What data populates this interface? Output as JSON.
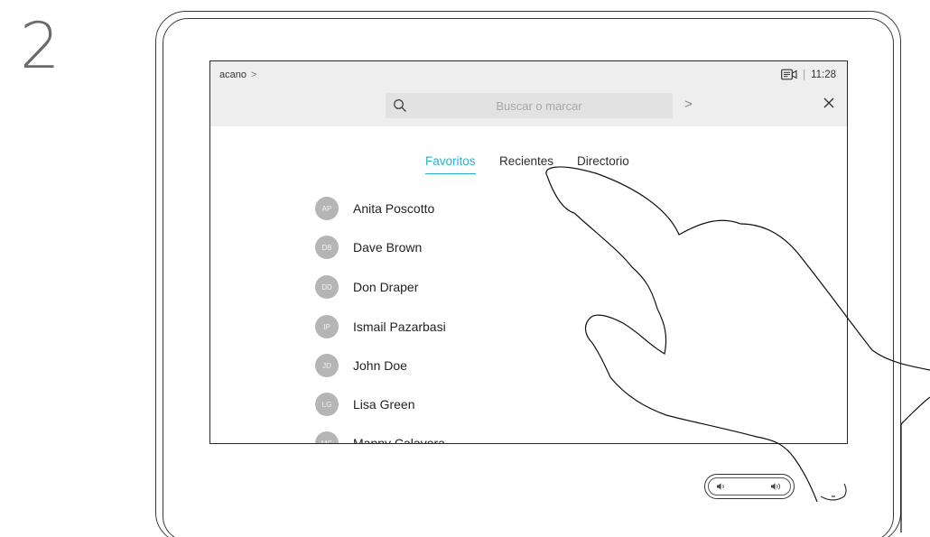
{
  "step_number": "2",
  "header": {
    "breadcrumb": "acano",
    "breadcrumb_chevron": ">",
    "time": "11:28",
    "separator": "|"
  },
  "search": {
    "placeholder": "Buscar o marcar",
    "go_arrow": ">"
  },
  "tabs": [
    {
      "label": "Favoritos",
      "active": true
    },
    {
      "label": "Recientes",
      "active": false
    },
    {
      "label": "Directorio",
      "active": false
    }
  ],
  "contacts": [
    {
      "initials": "AP",
      "name": "Anita Poscotto"
    },
    {
      "initials": "DB",
      "name": "Dave Brown"
    },
    {
      "initials": "DD",
      "name": "Don Draper"
    },
    {
      "initials": "IP",
      "name": "Ismail Pazarbasi"
    },
    {
      "initials": "JD",
      "name": "John Doe"
    },
    {
      "initials": "LG",
      "name": "Lisa Green"
    },
    {
      "initials": "MC",
      "name": "Manny Calavera"
    }
  ],
  "icons": {
    "search": "search-icon",
    "close": "close-icon",
    "camera": "camera-icon",
    "volume_down": "volume-down-icon",
    "volume_up": "volume-up-icon",
    "home": "home-icon",
    "hand": "hand-pointer-icon"
  },
  "colors": {
    "accent": "#2ab0c9",
    "avatar": "#b5b5b5",
    "topbar": "#eeeeee"
  }
}
